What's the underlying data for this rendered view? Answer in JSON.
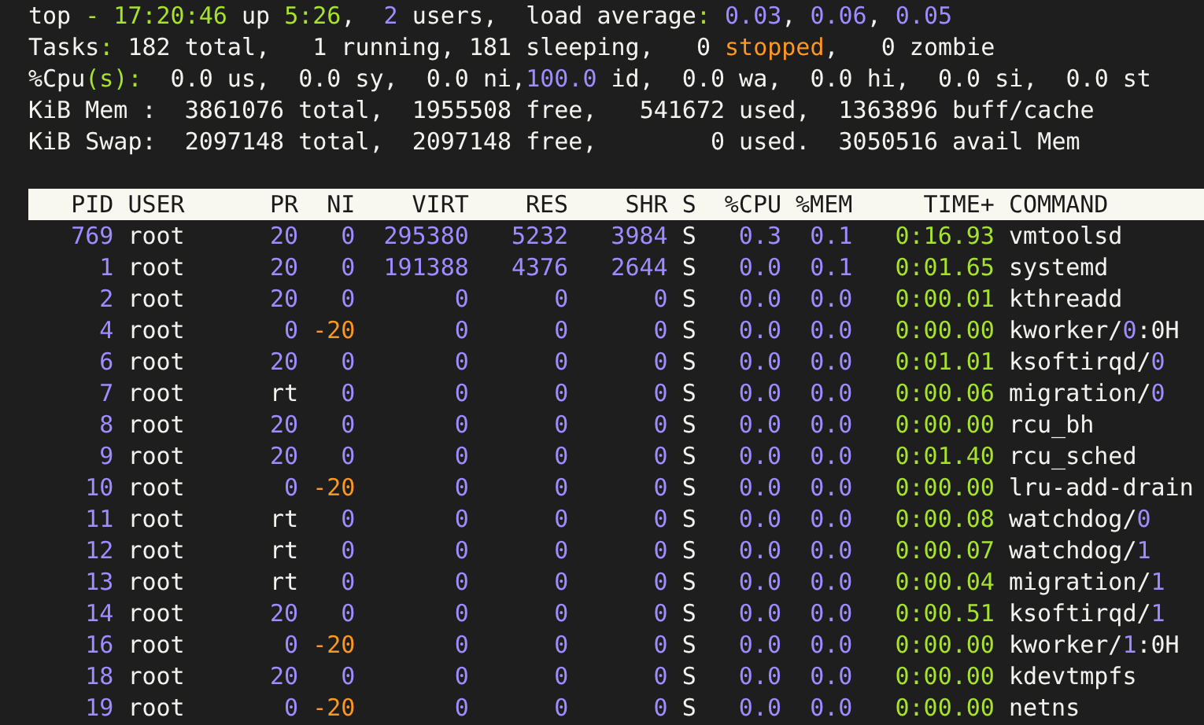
{
  "summary": [
    [
      {
        "text": "top ",
        "kind": "text"
      },
      {
        "text": "- 17:20:46",
        "kind": "time"
      },
      {
        "text": " up ",
        "kind": "text"
      },
      {
        "text": "5:26",
        "kind": "time"
      },
      {
        "text": ",  ",
        "kind": "text"
      },
      {
        "text": "2",
        "kind": "number"
      },
      {
        "text": " users,  load average",
        "kind": "text"
      },
      {
        "text": ":",
        "kind": "time"
      },
      {
        "text": " 0.03",
        "kind": "number"
      },
      {
        "text": ", ",
        "kind": "text"
      },
      {
        "text": "0.06",
        "kind": "number"
      },
      {
        "text": ", ",
        "kind": "text"
      },
      {
        "text": "0.05",
        "kind": "number"
      }
    ],
    [
      {
        "text": "Tasks",
        "kind": "text"
      },
      {
        "text": ":",
        "kind": "time"
      },
      {
        "text": " 182 total,   1 running, 181 sleeping,   0 ",
        "kind": "text"
      },
      {
        "text": "stopped",
        "kind": "warning"
      },
      {
        "text": ",   0 zombie",
        "kind": "text"
      }
    ],
    [
      {
        "text": "%Cpu",
        "kind": "text"
      },
      {
        "text": "(s):",
        "kind": "time"
      },
      {
        "text": "  0.0 us,  0.0 sy,  0.0 ni,",
        "kind": "text"
      },
      {
        "text": "100.0",
        "kind": "number"
      },
      {
        "text": " id,  0.0 wa,  0.0 hi,  0.0 si,  0.0 st",
        "kind": "text"
      }
    ],
    [
      {
        "text": "KiB Mem :  3861076 total,  1955508 free,   541672 used,  1363896 buff/cache",
        "kind": "text"
      }
    ],
    [
      {
        "text": "KiB Swap:  2097148 total,  2097148 free,        0 used.  3050516 avail Mem",
        "kind": "text"
      }
    ]
  ],
  "columns": [
    "PID",
    "USER",
    "PR",
    "NI",
    "VIRT",
    "RES",
    "SHR",
    "S",
    "%CPU",
    "%MEM",
    "TIME+",
    "COMMAND"
  ],
  "rows": [
    {
      "pid": "769",
      "user": "root",
      "pr": {
        "text": "20",
        "kind": "number"
      },
      "ni": {
        "text": "0",
        "kind": "number"
      },
      "virt": "295380",
      "res": "5232",
      "shr": "3984",
      "s": "S",
      "cpu": "0.3",
      "mem": "0.1",
      "time": "0:16.93",
      "command": [
        {
          "text": "vmtoolsd",
          "kind": "text"
        }
      ]
    },
    {
      "pid": "1",
      "user": "root",
      "pr": {
        "text": "20",
        "kind": "number"
      },
      "ni": {
        "text": "0",
        "kind": "number"
      },
      "virt": "191388",
      "res": "4376",
      "shr": "2644",
      "s": "S",
      "cpu": "0.0",
      "mem": "0.1",
      "time": "0:01.65",
      "command": [
        {
          "text": "systemd",
          "kind": "text"
        }
      ]
    },
    {
      "pid": "2",
      "user": "root",
      "pr": {
        "text": "20",
        "kind": "number"
      },
      "ni": {
        "text": "0",
        "kind": "number"
      },
      "virt": "0",
      "res": "0",
      "shr": "0",
      "s": "S",
      "cpu": "0.0",
      "mem": "0.0",
      "time": "0:00.01",
      "command": [
        {
          "text": "kthreadd",
          "kind": "text"
        }
      ]
    },
    {
      "pid": "4",
      "user": "root",
      "pr": {
        "text": "0",
        "kind": "number"
      },
      "ni": {
        "text": "-20",
        "kind": "warning"
      },
      "virt": "0",
      "res": "0",
      "shr": "0",
      "s": "S",
      "cpu": "0.0",
      "mem": "0.0",
      "time": "0:00.00",
      "command": [
        {
          "text": "kworker/",
          "kind": "text"
        },
        {
          "text": "0",
          "kind": "number"
        },
        {
          "text": ":0H",
          "kind": "text"
        }
      ]
    },
    {
      "pid": "6",
      "user": "root",
      "pr": {
        "text": "20",
        "kind": "number"
      },
      "ni": {
        "text": "0",
        "kind": "number"
      },
      "virt": "0",
      "res": "0",
      "shr": "0",
      "s": "S",
      "cpu": "0.0",
      "mem": "0.0",
      "time": "0:01.01",
      "command": [
        {
          "text": "ksoftirqd/",
          "kind": "text"
        },
        {
          "text": "0",
          "kind": "number"
        }
      ]
    },
    {
      "pid": "7",
      "user": "root",
      "pr": {
        "text": "rt",
        "kind": "text"
      },
      "ni": {
        "text": "0",
        "kind": "number"
      },
      "virt": "0",
      "res": "0",
      "shr": "0",
      "s": "S",
      "cpu": "0.0",
      "mem": "0.0",
      "time": "0:00.06",
      "command": [
        {
          "text": "migration/",
          "kind": "text"
        },
        {
          "text": "0",
          "kind": "number"
        }
      ]
    },
    {
      "pid": "8",
      "user": "root",
      "pr": {
        "text": "20",
        "kind": "number"
      },
      "ni": {
        "text": "0",
        "kind": "number"
      },
      "virt": "0",
      "res": "0",
      "shr": "0",
      "s": "S",
      "cpu": "0.0",
      "mem": "0.0",
      "time": "0:00.00",
      "command": [
        {
          "text": "rcu_bh",
          "kind": "text"
        }
      ]
    },
    {
      "pid": "9",
      "user": "root",
      "pr": {
        "text": "20",
        "kind": "number"
      },
      "ni": {
        "text": "0",
        "kind": "number"
      },
      "virt": "0",
      "res": "0",
      "shr": "0",
      "s": "S",
      "cpu": "0.0",
      "mem": "0.0",
      "time": "0:01.40",
      "command": [
        {
          "text": "rcu_sched",
          "kind": "text"
        }
      ]
    },
    {
      "pid": "10",
      "user": "root",
      "pr": {
        "text": "0",
        "kind": "number"
      },
      "ni": {
        "text": "-20",
        "kind": "warning"
      },
      "virt": "0",
      "res": "0",
      "shr": "0",
      "s": "S",
      "cpu": "0.0",
      "mem": "0.0",
      "time": "0:00.00",
      "command": [
        {
          "text": "lru-add-drain",
          "kind": "text"
        }
      ]
    },
    {
      "pid": "11",
      "user": "root",
      "pr": {
        "text": "rt",
        "kind": "text"
      },
      "ni": {
        "text": "0",
        "kind": "number"
      },
      "virt": "0",
      "res": "0",
      "shr": "0",
      "s": "S",
      "cpu": "0.0",
      "mem": "0.0",
      "time": "0:00.08",
      "command": [
        {
          "text": "watchdog/",
          "kind": "text"
        },
        {
          "text": "0",
          "kind": "number"
        }
      ]
    },
    {
      "pid": "12",
      "user": "root",
      "pr": {
        "text": "rt",
        "kind": "text"
      },
      "ni": {
        "text": "0",
        "kind": "number"
      },
      "virt": "0",
      "res": "0",
      "shr": "0",
      "s": "S",
      "cpu": "0.0",
      "mem": "0.0",
      "time": "0:00.07",
      "command": [
        {
          "text": "watchdog/",
          "kind": "text"
        },
        {
          "text": "1",
          "kind": "number"
        }
      ]
    },
    {
      "pid": "13",
      "user": "root",
      "pr": {
        "text": "rt",
        "kind": "text"
      },
      "ni": {
        "text": "0",
        "kind": "number"
      },
      "virt": "0",
      "res": "0",
      "shr": "0",
      "s": "S",
      "cpu": "0.0",
      "mem": "0.0",
      "time": "0:00.04",
      "command": [
        {
          "text": "migration/",
          "kind": "text"
        },
        {
          "text": "1",
          "kind": "number"
        }
      ]
    },
    {
      "pid": "14",
      "user": "root",
      "pr": {
        "text": "20",
        "kind": "number"
      },
      "ni": {
        "text": "0",
        "kind": "number"
      },
      "virt": "0",
      "res": "0",
      "shr": "0",
      "s": "S",
      "cpu": "0.0",
      "mem": "0.0",
      "time": "0:00.51",
      "command": [
        {
          "text": "ksoftirqd/",
          "kind": "text"
        },
        {
          "text": "1",
          "kind": "number"
        }
      ]
    },
    {
      "pid": "16",
      "user": "root",
      "pr": {
        "text": "0",
        "kind": "number"
      },
      "ni": {
        "text": "-20",
        "kind": "warning"
      },
      "virt": "0",
      "res": "0",
      "shr": "0",
      "s": "S",
      "cpu": "0.0",
      "mem": "0.0",
      "time": "0:00.00",
      "command": [
        {
          "text": "kworker/",
          "kind": "text"
        },
        {
          "text": "1",
          "kind": "number"
        },
        {
          "text": ":0H",
          "kind": "text"
        }
      ]
    },
    {
      "pid": "18",
      "user": "root",
      "pr": {
        "text": "20",
        "kind": "number"
      },
      "ni": {
        "text": "0",
        "kind": "number"
      },
      "virt": "0",
      "res": "0",
      "shr": "0",
      "s": "S",
      "cpu": "0.0",
      "mem": "0.0",
      "time": "0:00.00",
      "command": [
        {
          "text": "kdevtmpfs",
          "kind": "text"
        }
      ]
    },
    {
      "pid": "19",
      "user": "root",
      "pr": {
        "text": "0",
        "kind": "number"
      },
      "ni": {
        "text": "-20",
        "kind": "warning"
      },
      "virt": "0",
      "res": "0",
      "shr": "0",
      "s": "S",
      "cpu": "0.0",
      "mem": "0.0",
      "time": "0:00.00",
      "command": [
        {
          "text": "netns",
          "kind": "text"
        }
      ]
    }
  ]
}
